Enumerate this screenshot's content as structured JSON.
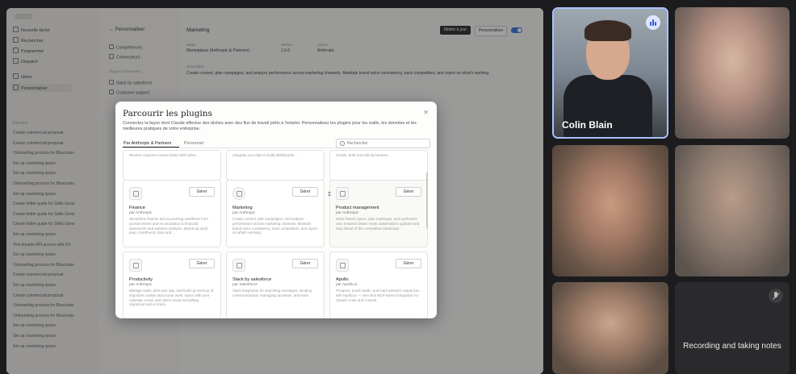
{
  "sidebar": {
    "nav": [
      "Nouvelle tâche",
      "Rechercher",
      "Programmé",
      "Dispatch",
      "Idées",
      "Personnaliser"
    ],
    "section_label": "Récents",
    "conversations": [
      "Create commercial proposal",
      "Create commercial proposal",
      "Onboarding process for Bluecoats",
      "Set up coworking space",
      "Set up coworking space",
      "Onboarding process for Bluecoats",
      "Set up coworking space",
      "Create folder guide for Skills Gene",
      "Create folder guide for Skills Gene",
      "Create folder guide for Skills Gene",
      "Set up coworking space",
      "Test dryable API access with DV",
      "Set up coworking space",
      "Onboarding process for Bluecoats",
      "Create commercial proposal",
      "Set up coworking space",
      "Create commercial proposal",
      "Onboarding process for Bluecoats",
      "Onboarding process for Bluecoats",
      "Set up coworking space",
      "Set up coworking space",
      "Set up coworking space"
    ]
  },
  "col2": {
    "title": "Personnaliser",
    "items": [
      "Compétences",
      "Connecteurs"
    ],
    "plugins_label": "Plugins personnels",
    "plugins": [
      "Slack by salesforce",
      "Customer support"
    ]
  },
  "detail": {
    "title": "Marketing",
    "fields": [
      {
        "label": "Statut",
        "value": "Marketplace (Anthropic & Partners)"
      },
      {
        "label": "Version",
        "value": "1.0.0"
      },
      {
        "label": "Auteur",
        "value": "Anthropic"
      }
    ],
    "description_label": "Description",
    "description": "Create content, plan campaigns, and analyze performance across marketing channels. Maintain brand voice consistency, track competitors, and report on what's working.",
    "btn_primary": "Mettre à jour",
    "btn_secondary": "Personnaliser"
  },
  "modal": {
    "title": "Parcourir les plugins",
    "description": "Connectez la façon dont Claude effectue des tâches avec des flux de travail prêts à l'emploi. Personnalisez les plugins pour les outils, les données et les meilleures pratiques de votre entreprise.",
    "tabs": [
      "Par Anthropic & Partners",
      "Personnel"
    ],
    "search_placeholder": "Rechercher",
    "manage_label": "Gérer",
    "partial_row": [
      "Resolve customer issues faster with better...",
      "Integrate your data to build dashboards...",
      "Create, draft and edit documents..."
    ],
    "plugins": [
      {
        "name": "Finance",
        "author": "par Anthropic",
        "desc": "Streamline finance and accounting workflows from journal entries and reconciliation to financial statements and variance analysis. Speed up audit prep, month-end close and ..."
      },
      {
        "name": "Marketing",
        "author": "par Anthropic",
        "desc": "Create content, plan campaigns, and analyze performance across marketing channels. Maintain brand voice consistency, track competitors, and report on what's working."
      },
      {
        "name": "Product management",
        "author": "par Anthropic",
        "desc": "Write feature specs, plan roadmaps, and synthesize user research faster. Keep stakeholders updated and stay ahead of the competitive landscape."
      },
      {
        "name": "Productivity",
        "author": "par Anthropic",
        "desc": "Manage tasks, plan your day, and build up memory of important context about your work. Syncs with your calendar, email, and chat to keep everything organized and on track."
      },
      {
        "name": "Slack by salesforce",
        "author": "par Salesforce",
        "desc": "Slack integration for searching messages, sending communications, managing canvases, and more."
      },
      {
        "name": "Apollo",
        "author": "par Apollo.io",
        "desc": "Prospect, enrich leads, and load outreach sequences with Apollo.io — one-click MCP server integration for Claude Code and Cowork."
      }
    ]
  },
  "video": {
    "main_participant": "Colin Blain",
    "recording_text": "Recording and taking notes"
  }
}
